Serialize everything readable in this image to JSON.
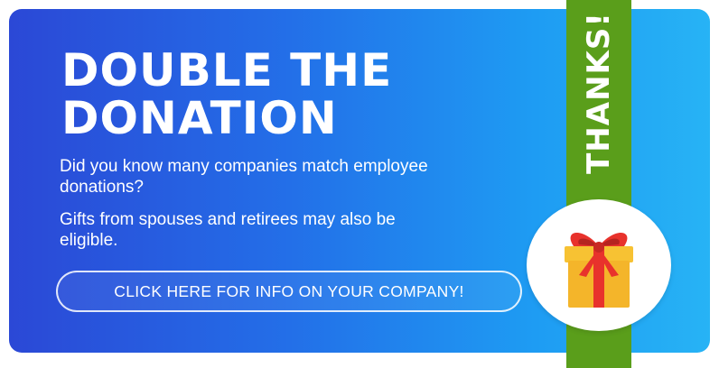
{
  "banner": {
    "title_lines": [
      "DOUBLE THE",
      "DONATION"
    ],
    "paragraph_1": "Did you know many companies match employee donations?",
    "paragraph_2": "Gifts from spouses and retirees may also be eligible.",
    "cta_label": "CLICK HERE FOR INFO ON YOUR COMPANY!",
    "ribbon_text": "THANKS!",
    "gift_icon": "gift-icon"
  },
  "colors": {
    "gradient_start": "#2b48d6",
    "gradient_end": "#27b3f5",
    "ribbon": "#5a9e1b",
    "gift_box": "#f7c233",
    "gift_bow": "#e8322c",
    "text": "#ffffff"
  }
}
